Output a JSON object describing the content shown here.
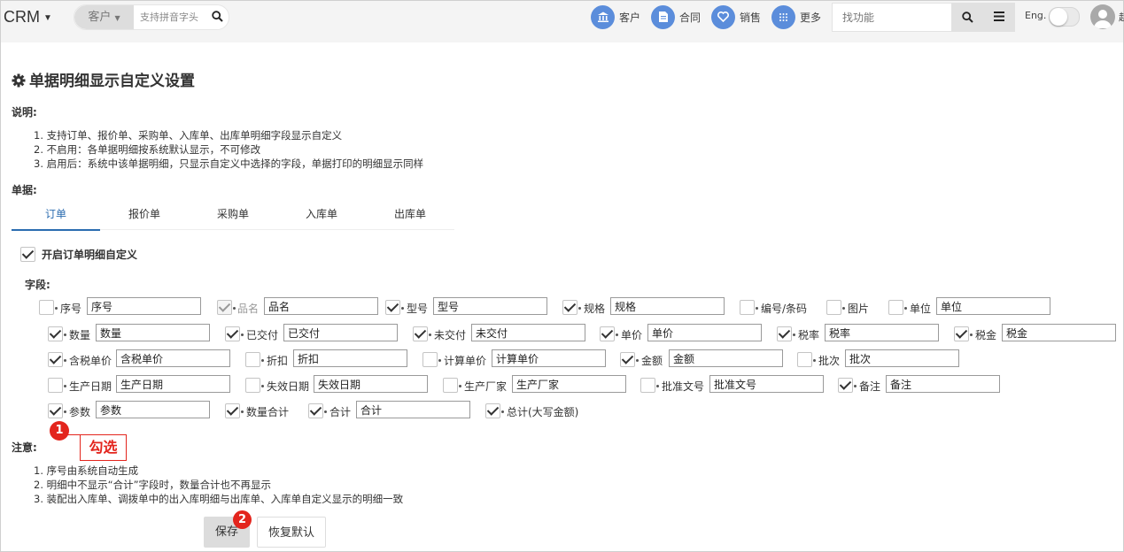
{
  "topbar": {
    "brand": "CRM",
    "search_scope": "客户",
    "search_placeholder": "支持拼音字头",
    "nav": [
      {
        "label": "客户",
        "icon": "bank-icon"
      },
      {
        "label": "合同",
        "icon": "document-icon"
      },
      {
        "label": "销售",
        "icon": "heart-icon"
      },
      {
        "label": "更多",
        "icon": "grid-icon"
      }
    ],
    "function_search_placeholder": "找功能",
    "language_label": "Eng.",
    "user_name_initial": "赵"
  },
  "page": {
    "title": "单据明细显示自定义设置",
    "description_label": "说明:",
    "description_items": [
      "1. 支持订单、报价单、采购单、入库单、出库单明细字段显示自定义",
      "2. 不启用：各单据明细按系统默认显示，不可修改",
      "3. 启用后：系统中该单据明细，只显示自定义中选择的字段，单据打印的明细显示同样"
    ],
    "document_label": "单据:",
    "tabs": [
      "订单",
      "报价单",
      "采购单",
      "入库单",
      "出库单"
    ],
    "active_tab": "订单",
    "enable_label": "开启订单明细自定义",
    "enable_checked": true,
    "fields_label": "字段:",
    "fields": [
      {
        "label": "序号",
        "value": "序号",
        "checked": false
      },
      {
        "label": "品名",
        "value": "品名",
        "checked": true,
        "disabled": true
      },
      {
        "label": "型号",
        "value": "型号",
        "checked": true
      },
      {
        "label": "规格",
        "value": "规格",
        "checked": true
      },
      {
        "label": "编号/条码",
        "checked": false
      },
      {
        "label": "图片",
        "checked": false
      },
      {
        "label": "单位",
        "value": "单位",
        "checked": false
      },
      {
        "label": "数量",
        "value": "数量",
        "checked": true
      },
      {
        "label": "已交付",
        "value": "已交付",
        "checked": true
      },
      {
        "label": "未交付",
        "value": "未交付",
        "checked": true
      },
      {
        "label": "单价",
        "value": "单价",
        "checked": true
      },
      {
        "label": "税率",
        "value": "税率",
        "checked": true
      },
      {
        "label": "税金",
        "value": "税金",
        "checked": true
      },
      {
        "label": "含税单价",
        "value": "含税单价",
        "checked": true
      },
      {
        "label": "折扣",
        "value": "折扣",
        "checked": false
      },
      {
        "label": "计算单价",
        "value": "计算单价",
        "checked": false
      },
      {
        "label": "金额",
        "value": "金额",
        "checked": true
      },
      {
        "label": "批次",
        "value": "批次",
        "checked": false
      },
      {
        "label": "生产日期",
        "value": "生产日期",
        "checked": false
      },
      {
        "label": "失效日期",
        "value": "失效日期",
        "checked": false
      },
      {
        "label": "生产厂家",
        "value": "生产厂家",
        "checked": false
      },
      {
        "label": "批准文号",
        "value": "批准文号",
        "checked": false
      },
      {
        "label": "备注",
        "value": "备注",
        "checked": true
      },
      {
        "label": "参数",
        "value": "参数",
        "checked": true
      },
      {
        "label": "数量合计",
        "checked": true
      },
      {
        "label": "合计",
        "value": "合计",
        "checked": true
      },
      {
        "label": "总计(大写金额)",
        "checked": true
      }
    ],
    "notes_label": "注意:",
    "notes": [
      "1. 序号由系统自动生成",
      "2. 明细中不显示“合计”字段时，数量合计也不再显示",
      "3. 装配出入库单、调拨单中的出入库明细与出库单、入库单自定义显示的明细一致"
    ],
    "save_label": "保存",
    "reset_label": "恢复默认"
  },
  "annotations": {
    "badge1": "1",
    "badge1_text": "勾选",
    "badge2": "2",
    "color": "#e3251d"
  },
  "colors": {
    "accent": "#2b6cb0",
    "nav_icon_bg": "#5b8ddb"
  }
}
